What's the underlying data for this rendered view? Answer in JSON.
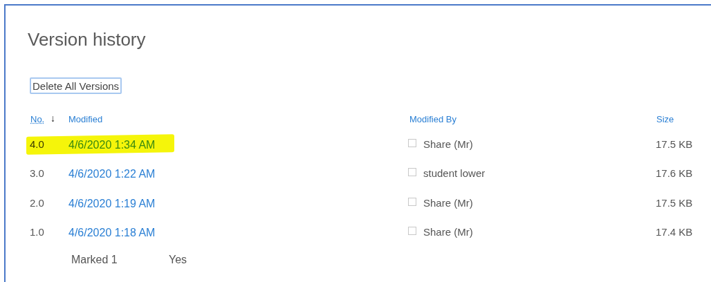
{
  "title": "Version history",
  "delete_button": "Delete All Versions",
  "columns": [
    {
      "label": "No.",
      "sorted": true,
      "sort_arrow": "↓"
    },
    {
      "label": "Modified",
      "sorted": false
    },
    {
      "label": "Modified By",
      "sorted": false
    },
    {
      "label": "Size",
      "sorted": false
    }
  ],
  "rows": [
    {
      "number": "4.0",
      "modified": "4/6/2020 1:34 AM",
      "modified_by": "Share (Mr)",
      "checked": false,
      "size": "17.5 KB",
      "highlighted": true
    },
    {
      "number": "3.0",
      "modified": "4/6/2020 1:22 AM",
      "modified_by": "student lower",
      "checked": false,
      "size": "17.6 KB",
      "highlighted": false
    },
    {
      "number": "2.0",
      "modified": "4/6/2020 1:19 AM",
      "modified_by": "Share (Mr)",
      "checked": false,
      "size": "17.5 KB",
      "highlighted": false
    },
    {
      "number": "1.0",
      "modified": "4/6/2020 1:18 AM",
      "modified_by": "Share (Mr)",
      "checked": false,
      "size": "17.4 KB",
      "highlighted": false
    }
  ],
  "footer": {
    "label": "Marked 1",
    "value": "Yes"
  }
}
